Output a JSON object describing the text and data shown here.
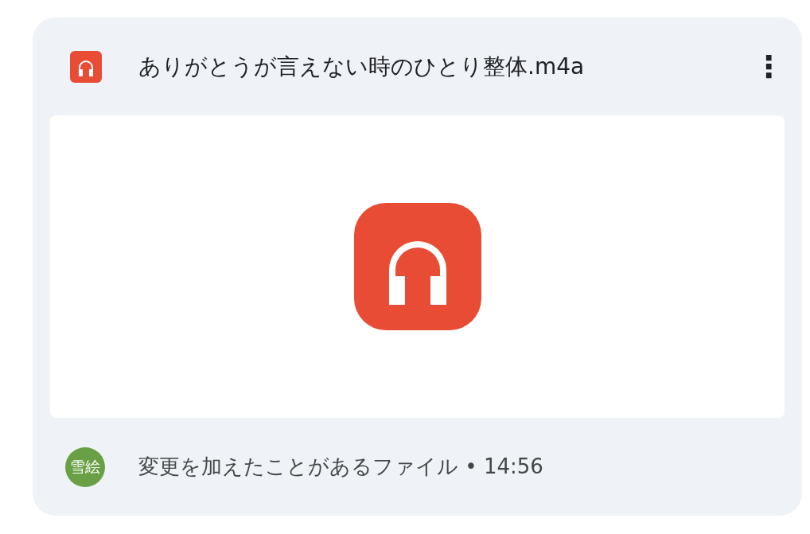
{
  "file": {
    "name": "ありがとうが言えない時のひとり整体.m4a",
    "menu_glyph": "⋮"
  },
  "footer": {
    "avatar": "雪絵",
    "activity": "変更を加えたことがあるファイル",
    "separator": "•",
    "time": "14:56"
  }
}
